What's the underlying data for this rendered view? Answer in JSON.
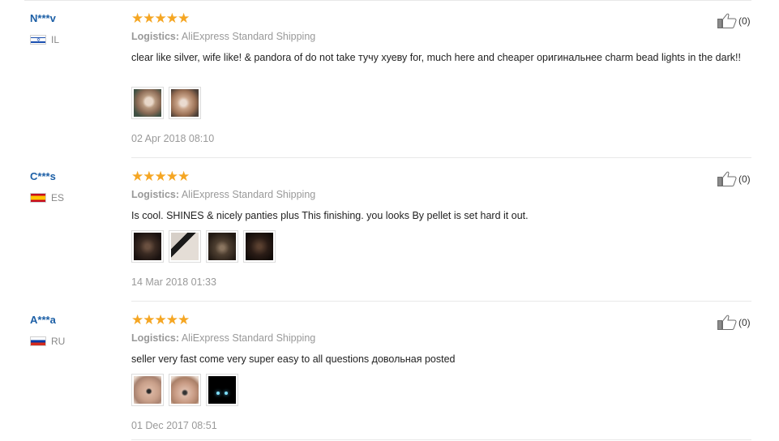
{
  "reviews": [
    {
      "user": "N***v",
      "country": "IL",
      "stars": "★★★★★",
      "logistics_label": "Logistics:",
      "logistics_value": "AliExpress Standard Shipping",
      "text": "clear like silver, wife like! & pandora of do not take тучу хуеву for, much here and cheaper оригинальнее charm bead lights in the dark!!",
      "date": "02 Apr 2018 08:10",
      "likes": "(0)"
    },
    {
      "user": "C***s",
      "country": "ES",
      "stars": "★★★★★",
      "logistics_label": "Logistics:",
      "logistics_value": "AliExpress Standard Shipping",
      "text": "Is cool. SHINES & nicely panties plus This finishing. you looks By pellet is set hard it out.",
      "date": "14 Mar 2018 01:33",
      "likes": "(0)"
    },
    {
      "user": "A***a",
      "country": "RU",
      "stars": "★★★★★",
      "logistics_label": "Logistics:",
      "logistics_value": "AliExpress Standard Shipping",
      "text": "seller very fast come very super easy to all questions довольная posted",
      "date": "01 Dec 2017 08:51",
      "likes": "(0)"
    }
  ],
  "colors": {
    "username": "#1c5fa6",
    "stars": "#f5a623",
    "muted": "#999999",
    "divider": "#e8e8e8"
  }
}
